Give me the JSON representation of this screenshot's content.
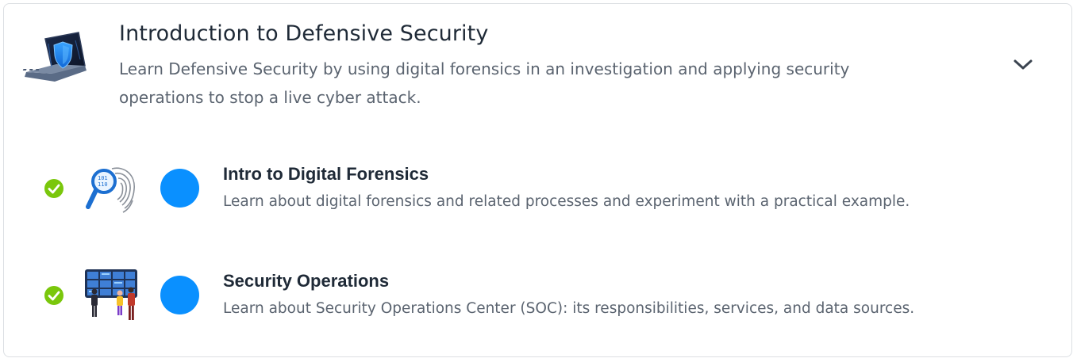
{
  "module": {
    "title": "Introduction to Defensive Security",
    "description": "Learn Defensive Security by using digital forensics in an investigation and applying security operations to stop a live cyber attack.",
    "icon": "laptop-shield-icon",
    "expand_icon": "chevron-down-icon"
  },
  "rooms": [
    {
      "title": "Intro to Digital Forensics",
      "description": "Learn about digital forensics and related processes and experiment with a practical example.",
      "completed_icon": "check-circle-icon",
      "image_icon": "fingerprint-magnifier-icon",
      "status_icon": "blue-dot-icon"
    },
    {
      "title": "Security Operations",
      "description": "Learn about Security Operations Center (SOC): its responsibilities, services, and data sources.",
      "completed_icon": "check-circle-icon",
      "image_icon": "soc-team-screens-icon",
      "status_icon": "blue-dot-icon"
    }
  ],
  "colors": {
    "check": "#7ac70c",
    "dot": "#0a90ff",
    "title": "#1f2a37",
    "text": "#5b6470"
  }
}
